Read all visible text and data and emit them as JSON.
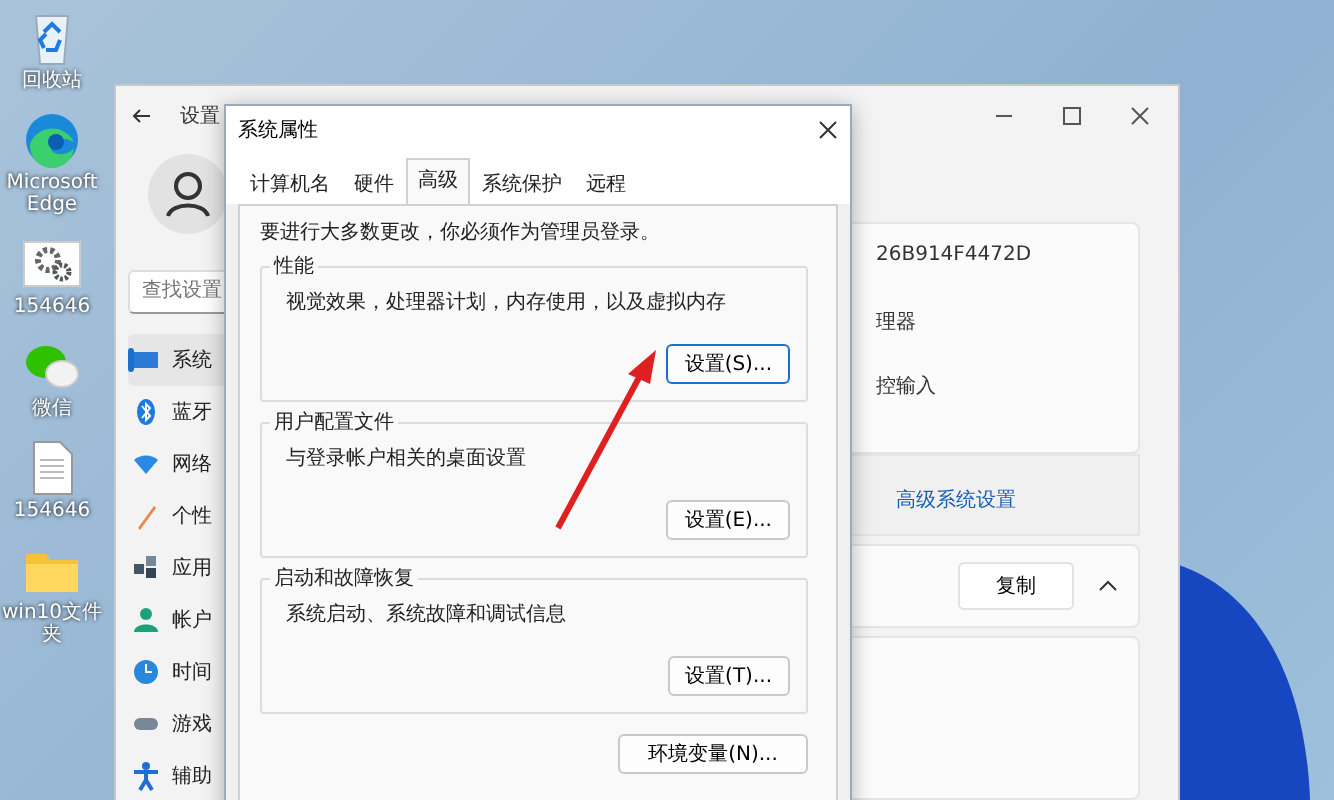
{
  "desktop_icons": [
    {
      "kind": "recycle",
      "label": "回收站"
    },
    {
      "kind": "edge",
      "label": "Microsoft Edge"
    },
    {
      "kind": "settings",
      "label": "154646"
    },
    {
      "kind": "chat",
      "label": "微信"
    },
    {
      "kind": "document",
      "label": "154646"
    },
    {
      "kind": "folder",
      "label": "win10文件夹"
    }
  ],
  "settings_window": {
    "title": "设置",
    "search_placeholder": "查找设置",
    "nav": [
      {
        "label": "系统",
        "selected": true
      },
      {
        "label": "蓝牙",
        "selected": false
      },
      {
        "label": "网络",
        "selected": false
      },
      {
        "label": "个性",
        "selected": false
      },
      {
        "label": "应用",
        "selected": false
      },
      {
        "label": "帐户",
        "selected": false
      },
      {
        "label": "时间",
        "selected": false
      },
      {
        "label": "游戏",
        "selected": false
      },
      {
        "label": "辅助",
        "selected": false
      }
    ],
    "info_lines": [
      "26B914F4472D",
      "理器",
      "控输入"
    ],
    "link": "高级系统设置",
    "copy_button": "复制"
  },
  "dialog": {
    "title": "系统属性",
    "tabs": [
      {
        "label": "计算机名",
        "selected": false
      },
      {
        "label": "硬件",
        "selected": false
      },
      {
        "label": "高级",
        "selected": true
      },
      {
        "label": "系统保护",
        "selected": false
      },
      {
        "label": "远程",
        "selected": false
      }
    ],
    "notice": "要进行大多数更改，你必须作为管理员登录。",
    "groups": [
      {
        "title": "性能",
        "description": "视觉效果，处理器计划，内存使用，以及虚拟内存",
        "button": "设置(S)..."
      },
      {
        "title": "用户配置文件",
        "description": "与登录帐户相关的桌面设置",
        "button": "设置(E)..."
      },
      {
        "title": "启动和故障恢复",
        "description": "系统启动、系统故障和调试信息",
        "button": "设置(T)..."
      }
    ],
    "env_button": "环境变量(N)..."
  }
}
